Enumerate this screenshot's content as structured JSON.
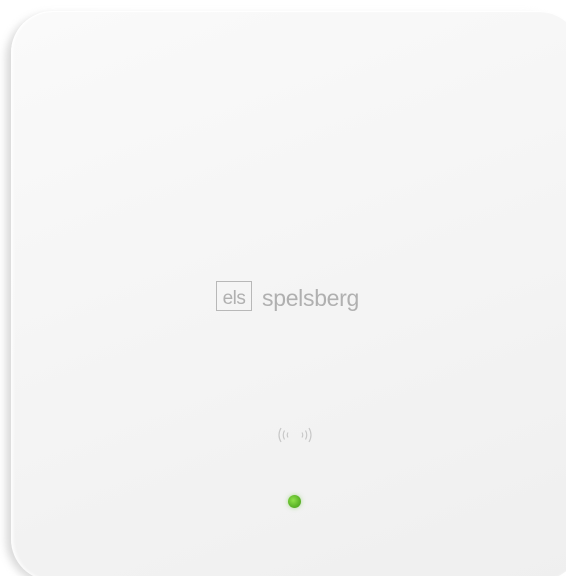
{
  "device": {
    "brand_box_text": "els",
    "brand_word": "spelsberg",
    "nfc_symbol": "nfc-icon",
    "status_led_color": "#6cc431",
    "body_color": "#f5f5f5"
  }
}
